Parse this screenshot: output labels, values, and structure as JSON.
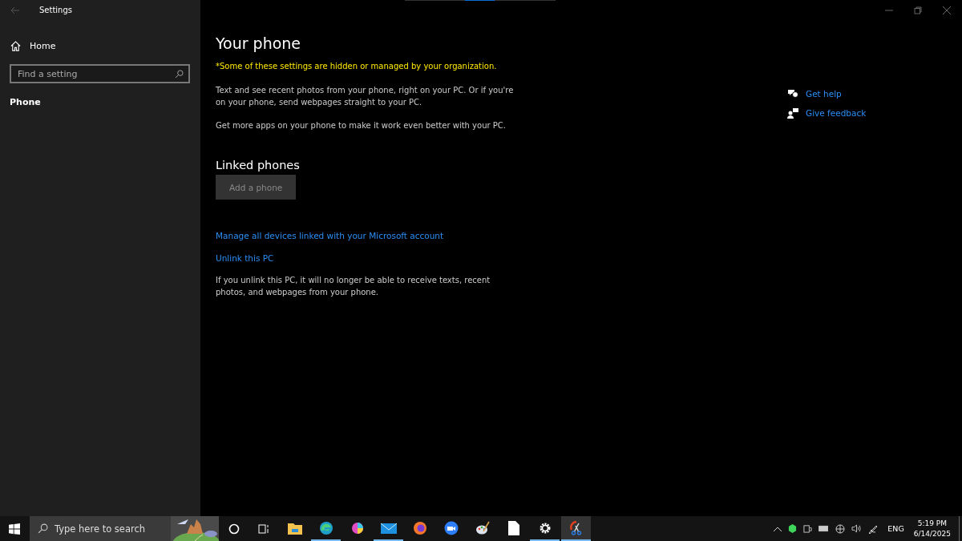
{
  "window": {
    "title": "Settings"
  },
  "sidebar": {
    "home": "Home",
    "search": {
      "placeholder": "Find a setting"
    },
    "items": [
      {
        "label": "Phone",
        "selected": true
      }
    ]
  },
  "page": {
    "title": "Your phone",
    "notice": "*Some of these settings are hidden or managed by your organization.",
    "paragraphs": [
      "Text and see recent photos from your phone, right on your PC. Or if you're on your phone, send webpages straight to your PC.",
      "Get more apps on your phone to make it work even better with your PC."
    ],
    "section_title": "Linked phones",
    "add_button": {
      "label": "Add a phone",
      "disabled": true
    },
    "links": [
      "Manage all devices linked with your Microsoft account",
      "Unlink this PC"
    ],
    "unlink_note": "If you unlink this PC, it will no longer be able to receive texts, recent photos, and webpages from your phone."
  },
  "help_links": [
    {
      "kind": "help",
      "label": "Get help"
    },
    {
      "kind": "feedback",
      "label": "Give feedback"
    }
  ],
  "taskbar": {
    "search": {
      "placeholder": "Type here to search"
    },
    "apps": [
      {
        "kind": "folder",
        "running": false,
        "active": false
      },
      {
        "kind": "edge",
        "running": true,
        "active": false
      },
      {
        "kind": "colorball",
        "running": false,
        "active": false
      },
      {
        "kind": "mail",
        "running": true,
        "active": false
      },
      {
        "kind": "firefox",
        "running": false,
        "active": false
      },
      {
        "kind": "zoom",
        "running": false,
        "active": false
      },
      {
        "kind": "palette",
        "running": false,
        "active": false
      },
      {
        "kind": "file",
        "running": false,
        "active": false
      },
      {
        "kind": "gear",
        "running": true,
        "active": false
      },
      {
        "kind": "scissors",
        "running": true,
        "active": true
      }
    ],
    "language": "ENG",
    "time": "5:19 PM",
    "date": "6/14/2025"
  }
}
